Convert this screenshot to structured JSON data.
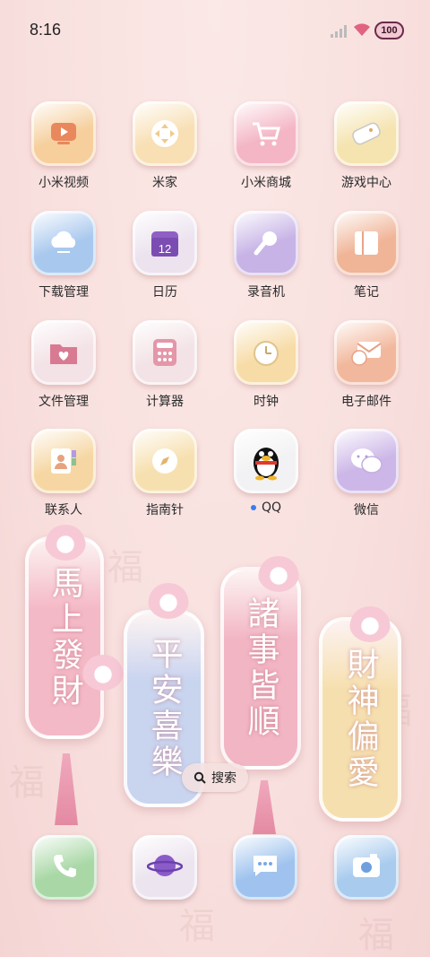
{
  "status_bar": {
    "time": "8:16",
    "battery": "100"
  },
  "apps": [
    {
      "label": "小米视频",
      "icon": "video-icon",
      "color": "#f6cf9d"
    },
    {
      "label": "米家",
      "icon": "mijia-icon",
      "color": "#f8dfb4"
    },
    {
      "label": "小米商城",
      "icon": "cart-icon",
      "color": "#f4b6c5"
    },
    {
      "label": "游戏中心",
      "icon": "gamepad-icon",
      "color": "#f5e4b0"
    },
    {
      "label": "下载管理",
      "icon": "cloud-download-icon",
      "color": "#a9c8ee"
    },
    {
      "label": "日历",
      "icon": "calendar-icon",
      "color": "#ece3ef",
      "date": "12"
    },
    {
      "label": "录音机",
      "icon": "microphone-icon",
      "color": "#c7b3e6"
    },
    {
      "label": "笔记",
      "icon": "notes-icon",
      "color": "#f0b497"
    },
    {
      "label": "文件管理",
      "icon": "folder-icon",
      "color": "#f3e2e6"
    },
    {
      "label": "计算器",
      "icon": "calculator-icon",
      "color": "#f3e3e6"
    },
    {
      "label": "时钟",
      "icon": "clock-icon",
      "color": "#f7dca7"
    },
    {
      "label": "电子邮件",
      "icon": "mail-icon",
      "color": "#f2b89d"
    },
    {
      "label": "联系人",
      "icon": "contacts-icon",
      "color": "#f6d7a4"
    },
    {
      "label": "指南针",
      "icon": "compass-icon",
      "color": "#f7e0b0"
    },
    {
      "label": "QQ",
      "icon": "qq-penguin-icon",
      "color": "#f2f2f4",
      "badge_dot": true
    },
    {
      "label": "微信",
      "icon": "wechat-icon",
      "color": "#cdb7e8"
    }
  ],
  "lanterns": [
    {
      "text": "馬上發財",
      "color": "#f4b9c6"
    },
    {
      "text": "平安喜樂",
      "color": "#c9d4ef"
    },
    {
      "text": "諸事皆順",
      "color": "#f2b5c3"
    },
    {
      "text": "財神偏愛",
      "color": "#f6dfae"
    }
  ],
  "search": {
    "label": "搜索",
    "icon": "search-icon"
  },
  "dock": [
    {
      "icon": "phone-icon",
      "color": "#a9d8a6"
    },
    {
      "icon": "browser-planet-icon",
      "color": "#ece4ef"
    },
    {
      "icon": "messages-icon",
      "color": "#9fc3ee"
    },
    {
      "icon": "camera-icon",
      "color": "#a8cbee"
    }
  ]
}
